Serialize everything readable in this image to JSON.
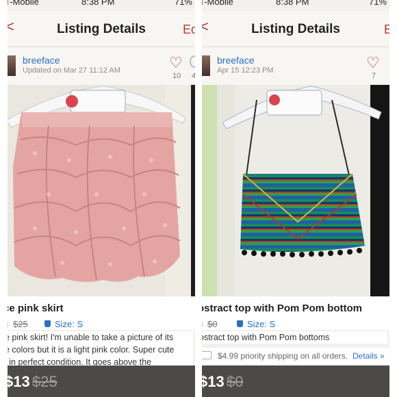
{
  "status": {
    "carrier": "T-Mobile",
    "time": "8:38 PM",
    "battery": "71%"
  },
  "listings": [
    {
      "nav": {
        "back": "<",
        "title": "Listing Details",
        "edit": "Ed"
      },
      "user": {
        "name": "breeface",
        "updated": "Updated on Mar 27 11:12 AM"
      },
      "likes": "10",
      "comments": "4",
      "title": "ce pink skirt",
      "price_lead": "3",
      "original_price": "$25",
      "size": "Size: S",
      "description": [
        "e pink skirt! I'm unable to take a picture of its",
        "e colors but it is a light pink color. Super cute",
        "l in perfect condition. It goes above the"
      ],
      "bottom_price": "$13",
      "bottom_original": "$25"
    },
    {
      "nav": {
        "back": "<",
        "title": "Listing Details",
        "edit": "E"
      },
      "user": {
        "name": "breeface",
        "updated": "Apr 15 12:23 PM"
      },
      "likes": "7",
      "title": "ostract top with Pom Pom bottom",
      "price_lead": "3",
      "original_price": "$0",
      "size": "Size: S",
      "description": [
        "ostract top with Pom Pom bottoms"
      ],
      "shipping": "$4.99 priority shipping on all orders.",
      "shipping_link": "Details »",
      "bottom_price": "$13",
      "bottom_original": "$0"
    }
  ],
  "colors": {
    "brand_red": "#c0392b",
    "link_blue": "#2b6fc0",
    "bottom_bar": "#4b4a47"
  }
}
